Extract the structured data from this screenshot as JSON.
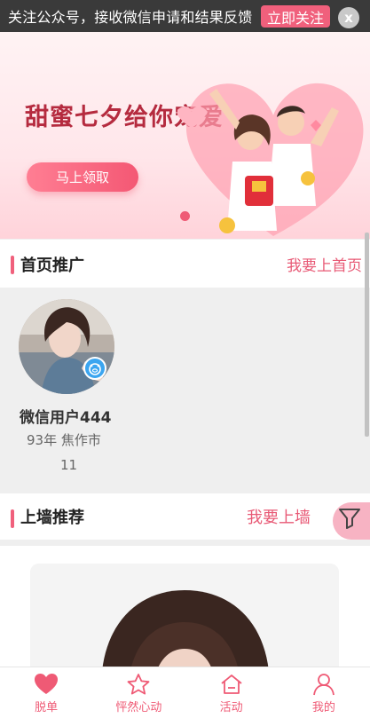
{
  "notice": {
    "text": "关注公众号，接收微信申请和结果反馈",
    "follow_label": "立即关注",
    "close_label": "x"
  },
  "banner": {
    "slogan": "甜蜜七夕给你宠爱",
    "claim_label": "马上领取"
  },
  "homepage_promo": {
    "title": "首页推广",
    "action_label": "我要上首页",
    "user": {
      "name": "微信用户444",
      "info": "93年  焦作市",
      "count": "11"
    }
  },
  "wall": {
    "title": "上墙推荐",
    "action_label": "我要上墙"
  },
  "tabbar": {
    "items": [
      {
        "label": "脱单",
        "icon": "heart-icon"
      },
      {
        "label": "怦然心动",
        "icon": "star-icon"
      },
      {
        "label": "活动",
        "icon": "home-icon"
      },
      {
        "label": "我的",
        "icon": "user-icon"
      }
    ]
  },
  "colors": {
    "accent": "#f0607c",
    "notice_bg": "#3a3a3a"
  }
}
